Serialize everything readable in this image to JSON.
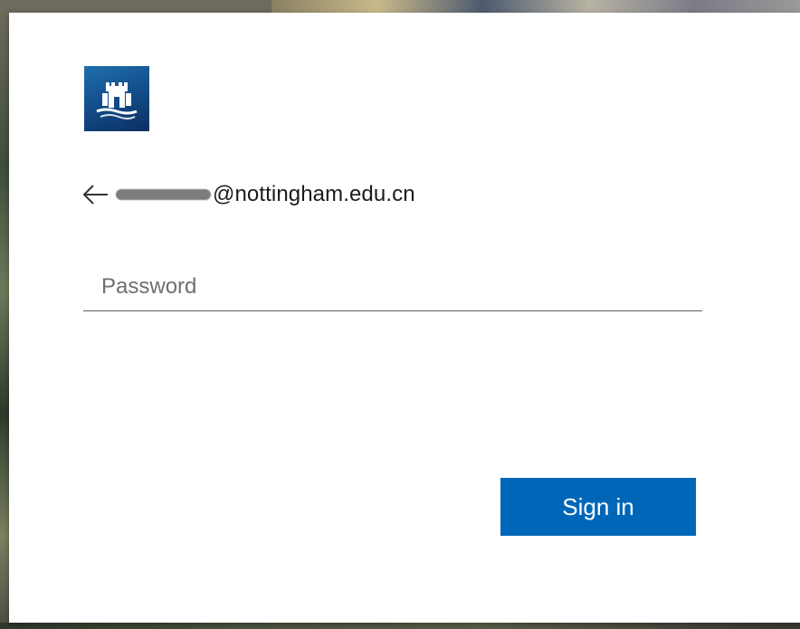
{
  "identity": {
    "email_domain": "@nottingham.edu.cn"
  },
  "password": {
    "placeholder": "Password"
  },
  "actions": {
    "sign_in_label": "Sign in"
  },
  "icons": {
    "back": "back-arrow-icon",
    "logo": "university-castle-logo"
  },
  "colors": {
    "primary_button": "#0067b8",
    "logo_blue": "#124a86"
  }
}
